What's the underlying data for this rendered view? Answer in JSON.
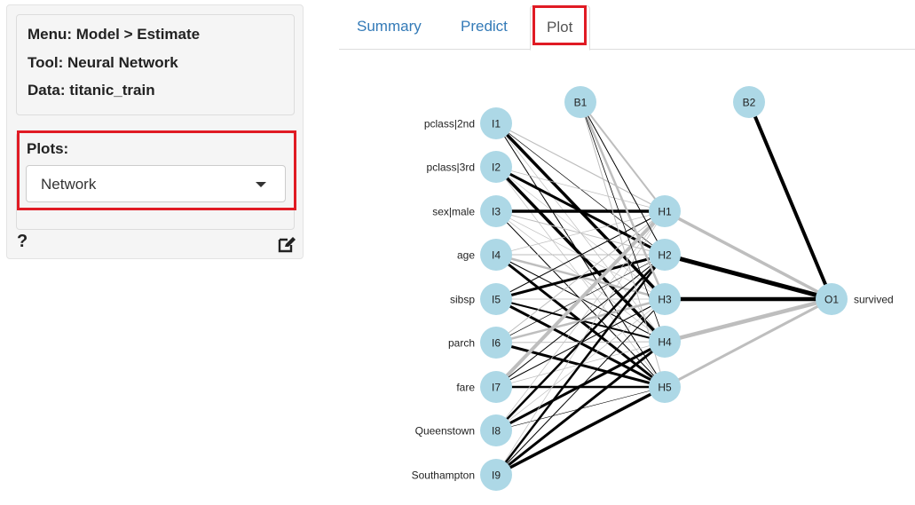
{
  "sidebar": {
    "menu": "Menu: Model > Estimate",
    "tool": "Tool: Neural Network",
    "data": "Data: titanic_train",
    "plots_label": "Plots:",
    "plots_selected": "Network",
    "help_icon": "?"
  },
  "tabs": [
    "Summary",
    "Predict",
    "Plot"
  ],
  "active_tab": "Plot",
  "highlight_color": "#e01b24",
  "network": {
    "input_labels": [
      "pclass|2nd",
      "pclass|3rd",
      "sex|male",
      "age",
      "sibsp",
      "parch",
      "fare",
      "Queenstown",
      "Southampton"
    ],
    "input_nodes": [
      "I1",
      "I2",
      "I3",
      "I4",
      "I5",
      "I6",
      "I7",
      "I8",
      "I9"
    ],
    "hidden_nodes": [
      "H1",
      "H2",
      "H3",
      "H4",
      "H5"
    ],
    "bias_nodes": [
      "B1",
      "B2"
    ],
    "output_nodes": [
      "O1"
    ],
    "output_label": "survived",
    "node_color": "#add8e6",
    "positive_color": "#000000",
    "negative_color": "#bebebe"
  }
}
